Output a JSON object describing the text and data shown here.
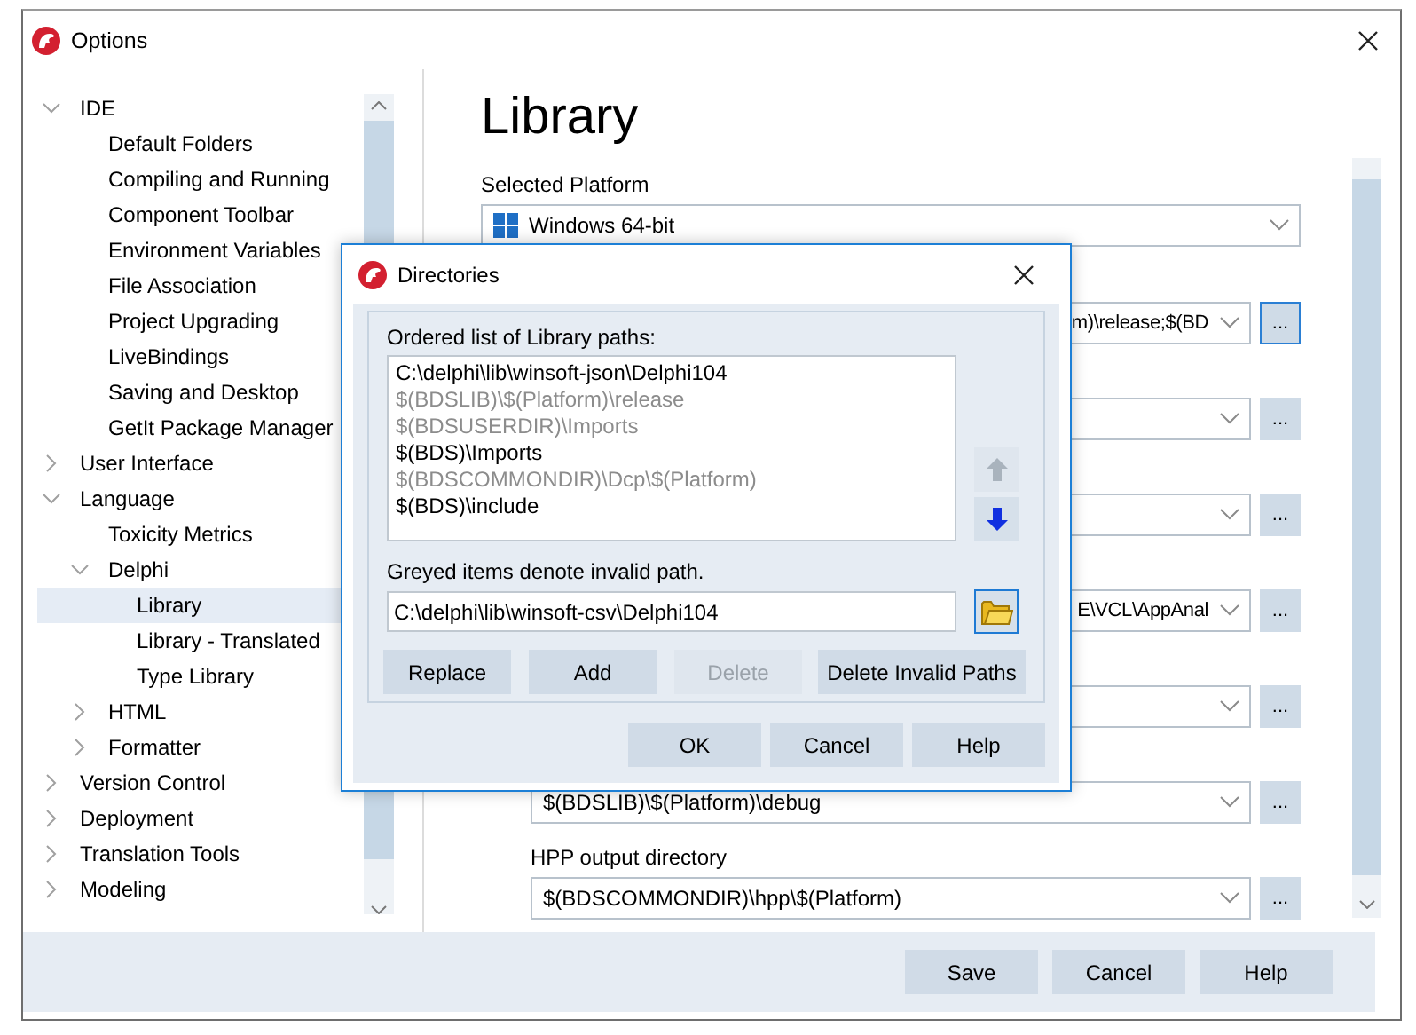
{
  "window": {
    "title": "Options"
  },
  "tree": [
    {
      "label": "IDE",
      "expanded": true,
      "selected": false,
      "children": [
        {
          "label": "Default Folders",
          "selected": false
        },
        {
          "label": "Compiling and Running",
          "selected": false
        },
        {
          "label": "Component Toolbar",
          "selected": false
        },
        {
          "label": "Environment Variables",
          "selected": false
        },
        {
          "label": "File Association",
          "selected": false
        },
        {
          "label": "Project Upgrading",
          "selected": false
        },
        {
          "label": "LiveBindings",
          "selected": false
        },
        {
          "label": "Saving and Desktop",
          "selected": false
        },
        {
          "label": "GetIt Package Manager",
          "selected": false
        }
      ]
    },
    {
      "label": "User Interface",
      "expanded": false,
      "selected": false
    },
    {
      "label": "Language",
      "expanded": true,
      "selected": false,
      "children": [
        {
          "label": "Toxicity Metrics",
          "selected": false
        },
        {
          "label": "Delphi",
          "expanded": true,
          "selected": false,
          "children": [
            {
              "label": "Library",
              "selected": true
            },
            {
              "label": "Library - Translated",
              "selected": false
            },
            {
              "label": "Type Library",
              "selected": false
            }
          ]
        },
        {
          "label": "HTML",
          "expanded": false,
          "selected": false
        },
        {
          "label": "Formatter",
          "expanded": false,
          "selected": false
        }
      ]
    },
    {
      "label": "Version Control",
      "expanded": false,
      "selected": false
    },
    {
      "label": "Deployment",
      "expanded": false,
      "selected": false
    },
    {
      "label": "Translation Tools",
      "expanded": false,
      "selected": false
    },
    {
      "label": "Modeling",
      "expanded": false,
      "selected": false
    }
  ],
  "pane": {
    "title": "Library",
    "platform": {
      "label": "Selected Platform",
      "value": "Windows 64-bit"
    },
    "rows": [
      {
        "value": "m)\\release;$(BD",
        "cut": true,
        "button": "...",
        "focused": true
      },
      {
        "button": "...",
        "focused": false
      },
      {
        "button": "...",
        "focused": false
      },
      {
        "value": "E\\VCL\\AppAnal",
        "cut": true,
        "button": "...",
        "focused": false
      },
      {
        "button": "...",
        "focused": false
      },
      {
        "value": "$(BDSLIB)\\$(Platform)\\debug",
        "cut": false,
        "button": "...",
        "focused": false
      },
      {
        "label": "HPP output directory",
        "value": "$(BDSCOMMONDIR)\\hpp\\$(Platform)",
        "cut": false,
        "button": "...",
        "focused": false
      }
    ]
  },
  "footer": {
    "buttons": [
      {
        "label": "Save"
      },
      {
        "label": "Cancel"
      },
      {
        "label": "Help"
      }
    ]
  },
  "dialog": {
    "title": "Directories",
    "list_label": "Ordered list of Library paths:",
    "paths": [
      {
        "text": "C:\\delphi\\lib\\winsoft-json\\Delphi104",
        "valid": true
      },
      {
        "text": "$(BDSLIB)\\$(Platform)\\release",
        "valid": false
      },
      {
        "text": "$(BDSUSERDIR)\\Imports",
        "valid": false
      },
      {
        "text": "$(BDS)\\Imports",
        "valid": true
      },
      {
        "text": "$(BDSCOMMONDIR)\\Dcp\\$(Platform)",
        "valid": false
      },
      {
        "text": "$(BDS)\\include",
        "valid": true
      }
    ],
    "move_up": {
      "disabled": true
    },
    "move_down": {
      "disabled": false
    },
    "hint": "Greyed items denote invalid path.",
    "path_value": "C:\\delphi\\lib\\winsoft-csv\\Delphi104",
    "browse": {
      "focused": true
    },
    "actions": [
      {
        "label": "Replace",
        "disabled": false
      },
      {
        "label": "Add",
        "disabled": false
      },
      {
        "label": "Delete",
        "disabled": true
      },
      {
        "label": "Delete Invalid Paths",
        "disabled": false
      }
    ],
    "buttons": [
      {
        "label": "OK"
      },
      {
        "label": "Cancel"
      },
      {
        "label": "Help"
      }
    ]
  }
}
